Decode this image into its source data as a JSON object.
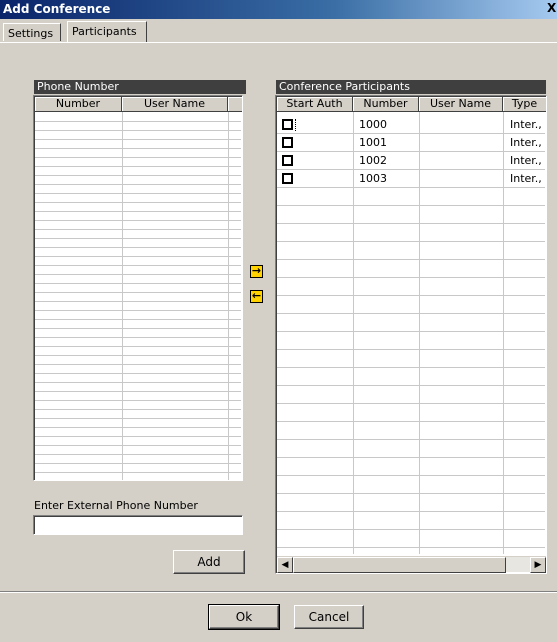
{
  "window": {
    "title": "Add Conference",
    "close_glyph": "X"
  },
  "tabs": [
    {
      "label": "Settings"
    },
    {
      "label": "Participants"
    }
  ],
  "phone_panel": {
    "title": "Phone Number",
    "columns": [
      "Number",
      "User Name"
    ]
  },
  "participants_panel": {
    "title": "Conference Participants",
    "columns": [
      "Start Auth",
      "Number",
      "User Name",
      "Type"
    ],
    "rows": [
      {
        "checked": false,
        "number": "1000",
        "user_name": "",
        "type": "Inter.,"
      },
      {
        "checked": false,
        "number": "1001",
        "user_name": "",
        "type": "Inter.,"
      },
      {
        "checked": false,
        "number": "1002",
        "user_name": "",
        "type": "Inter.,"
      },
      {
        "checked": false,
        "number": "1003",
        "user_name": "",
        "type": "Inter.,"
      }
    ]
  },
  "arrows": {
    "add_icon": "arrow-right-icon",
    "remove_icon": "arrow-left-icon",
    "add_glyph": "→",
    "remove_glyph": "←"
  },
  "external": {
    "label": "Enter External Phone Number",
    "value": "",
    "add_button": "Add"
  },
  "footer": {
    "ok": "Ok",
    "cancel": "Cancel"
  },
  "colors": {
    "accent": "#ffd200",
    "panel_header": "#3f3f3f",
    "title_start": "#0a246a"
  }
}
